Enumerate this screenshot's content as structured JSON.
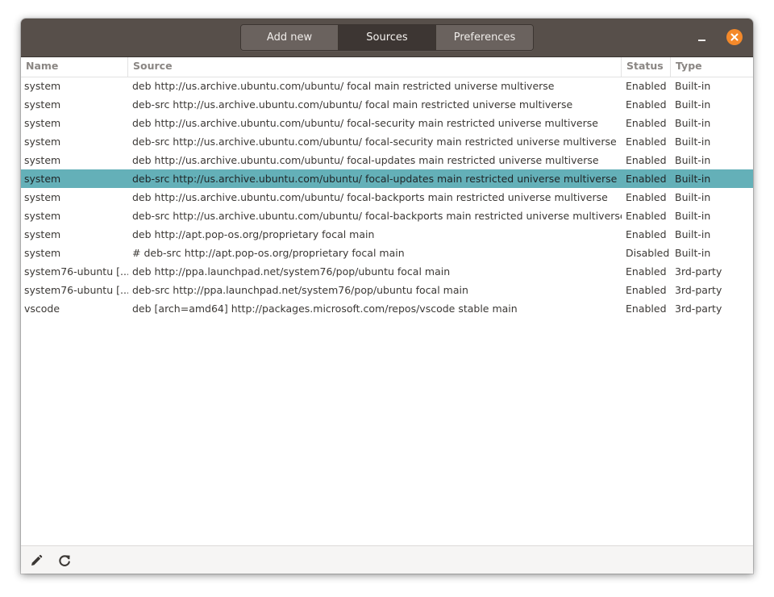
{
  "tabs": [
    {
      "label": "Add new",
      "active": false
    },
    {
      "label": "Sources",
      "active": true
    },
    {
      "label": "Preferences",
      "active": false
    }
  ],
  "window_controls": {
    "minimize_icon": "minimize-icon",
    "close_icon": "close-icon",
    "close_color": "#f4892a"
  },
  "columns": {
    "name": "Name",
    "source": "Source",
    "status": "Status",
    "type": "Type"
  },
  "rows": [
    {
      "name": "system",
      "source": "deb http://us.archive.ubuntu.com/ubuntu/ focal main restricted universe multiverse",
      "status": "Enabled",
      "type": "Built-in"
    },
    {
      "name": "system",
      "source": "deb-src http://us.archive.ubuntu.com/ubuntu/ focal main restricted universe multiverse",
      "status": "Enabled",
      "type": "Built-in"
    },
    {
      "name": "system",
      "source": "deb http://us.archive.ubuntu.com/ubuntu/ focal-security main restricted universe multiverse",
      "status": "Enabled",
      "type": "Built-in"
    },
    {
      "name": "system",
      "source": "deb-src http://us.archive.ubuntu.com/ubuntu/ focal-security main restricted universe multiverse",
      "status": "Enabled",
      "type": "Built-in"
    },
    {
      "name": "system",
      "source": "deb http://us.archive.ubuntu.com/ubuntu/ focal-updates main restricted universe multiverse",
      "status": "Enabled",
      "type": "Built-in"
    },
    {
      "name": "system",
      "source": "deb-src http://us.archive.ubuntu.com/ubuntu/ focal-updates main restricted universe multiverse",
      "status": "Enabled",
      "type": "Built-in",
      "selected": true
    },
    {
      "name": "system",
      "source": "deb http://us.archive.ubuntu.com/ubuntu/ focal-backports main restricted universe multiverse",
      "status": "Enabled",
      "type": "Built-in"
    },
    {
      "name": "system",
      "source": "deb-src http://us.archive.ubuntu.com/ubuntu/ focal-backports main restricted universe multiverse",
      "status": "Enabled",
      "type": "Built-in"
    },
    {
      "name": "system",
      "source": "deb http://apt.pop-os.org/proprietary focal main",
      "status": "Enabled",
      "type": "Built-in"
    },
    {
      "name": "system",
      "source": "# deb-src http://apt.pop-os.org/proprietary focal main",
      "status": "Disabled",
      "type": "Built-in"
    },
    {
      "name": "system76-ubuntu [...]",
      "source": "deb http://ppa.launchpad.net/system76/pop/ubuntu focal main",
      "status": "Enabled",
      "type": "3rd-party"
    },
    {
      "name": "system76-ubuntu [...]",
      "source": "deb-src http://ppa.launchpad.net/system76/pop/ubuntu focal main",
      "status": "Enabled",
      "type": "3rd-party"
    },
    {
      "name": "vscode",
      "source": "deb [arch=amd64] http://packages.microsoft.com/repos/vscode stable main",
      "status": "Enabled",
      "type": "3rd-party"
    }
  ],
  "footer": {
    "edit_icon": "pencil-icon",
    "refresh_icon": "refresh-icon"
  },
  "colors": {
    "titlebar": "#574f4a",
    "selection": "#64b0b8",
    "accent": "#f4892a"
  }
}
